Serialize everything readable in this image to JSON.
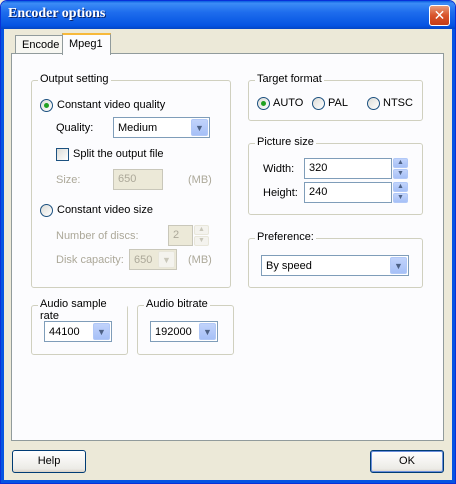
{
  "window": {
    "title": "Encoder options",
    "close_glyph": "✕"
  },
  "tabs": [
    {
      "label": "Encode"
    },
    {
      "label": "Mpeg1"
    }
  ],
  "output_setting": {
    "legend": "Output setting",
    "constant_quality_label": "Constant video quality",
    "quality_label": "Quality:",
    "quality_value": "Medium",
    "split_label": "Split the output file",
    "size_label": "Size:",
    "size_value": "650",
    "size_unit": "(MB)",
    "constant_size_label": "Constant video size",
    "discs_label": "Number of discs:",
    "discs_value": "2",
    "capacity_label": "Disk capacity:",
    "capacity_value": "650",
    "capacity_unit": "(MB)"
  },
  "target_format": {
    "legend": "Target format",
    "options": [
      {
        "label": "AUTO"
      },
      {
        "label": "PAL"
      },
      {
        "label": "NTSC"
      }
    ]
  },
  "picture_size": {
    "legend": "Picture size",
    "width_label": "Width:",
    "width_value": "320",
    "height_label": "Height:",
    "height_value": "240"
  },
  "preference": {
    "legend": "Preference:",
    "value": "By speed"
  },
  "audio_sample_rate": {
    "legend": "Audio sample rate",
    "value": "44100"
  },
  "audio_bitrate": {
    "legend": "Audio bitrate",
    "value": "192000"
  },
  "buttons": {
    "help": "Help",
    "ok": "OK"
  },
  "icons": {
    "dropdown": "▼",
    "spin_up": "▲",
    "spin_down": "▼"
  }
}
